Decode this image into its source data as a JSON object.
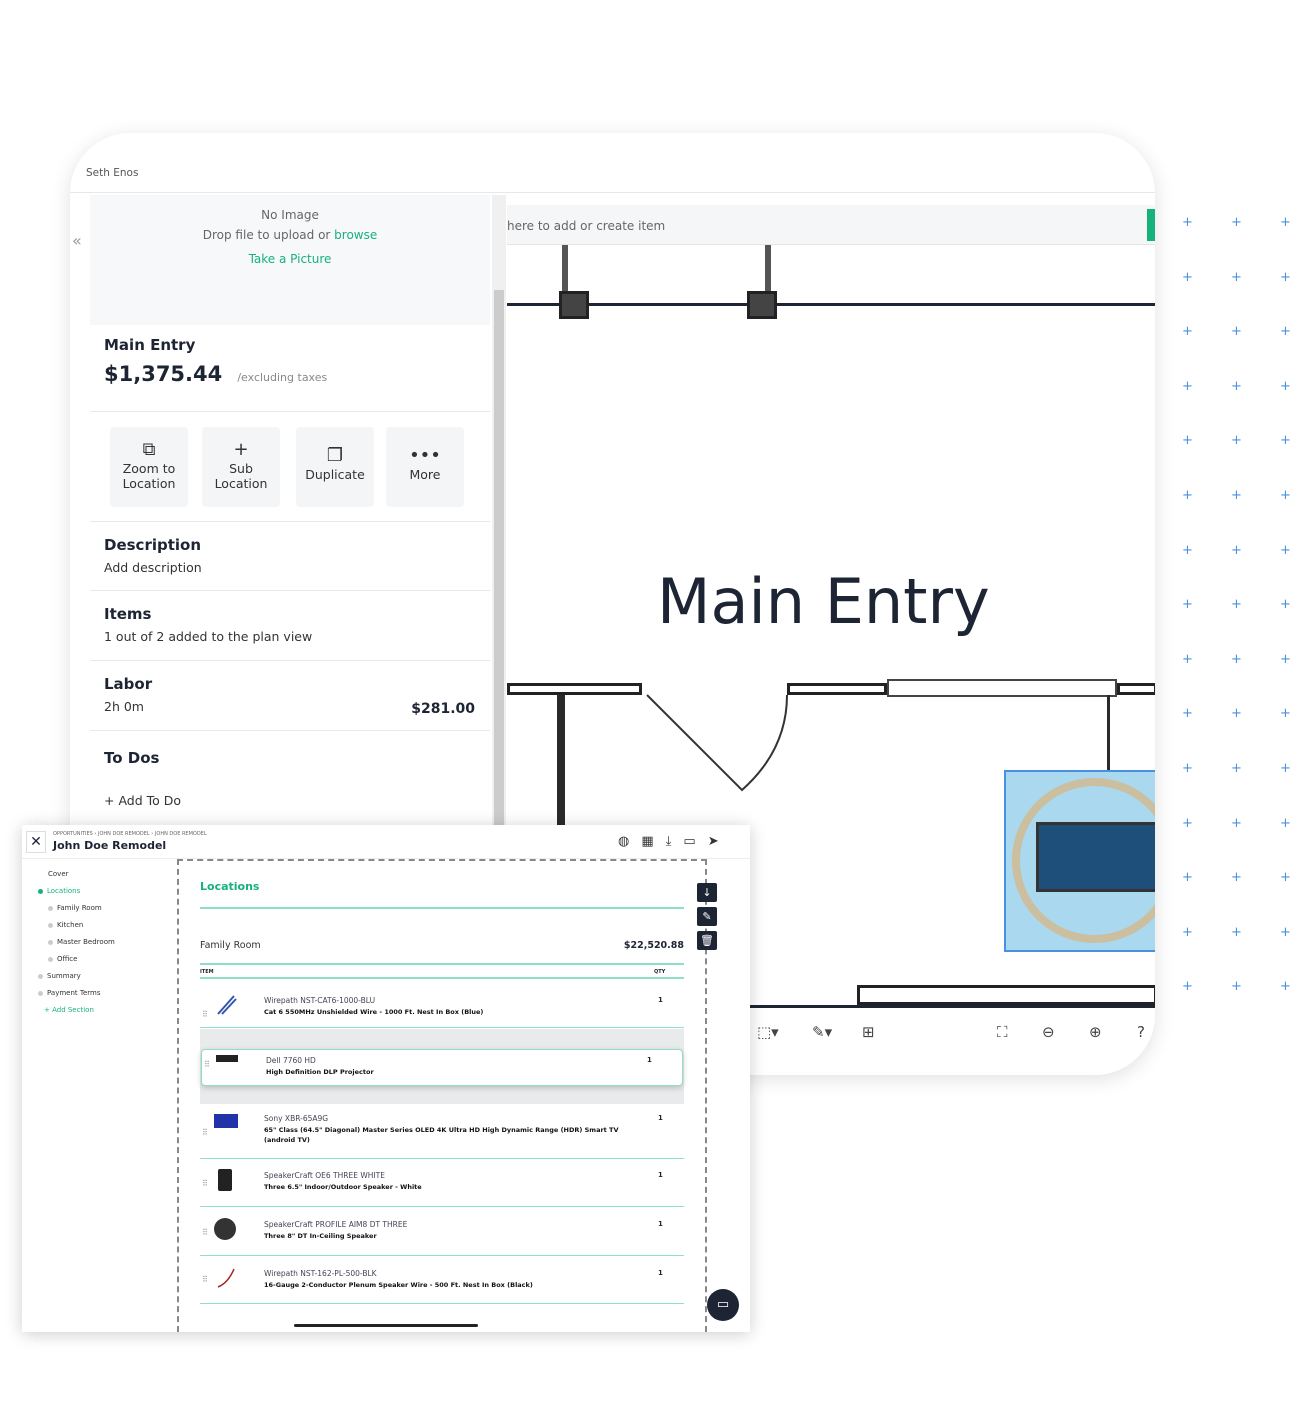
{
  "back_window": {
    "user_name": "Seth Enos",
    "image_area": {
      "no_image": "No Image",
      "drop_text": "Drop file to upload or",
      "browse": "browse",
      "take_picture": "Take a Picture"
    },
    "location": {
      "name": "Main Entry",
      "price": "$1,375.44",
      "price_note": "/excluding taxes"
    },
    "actions": [
      {
        "label": "Zoom to Location",
        "icon": "zoom-location-icon"
      },
      {
        "label": "Sub Location",
        "icon": "plus-icon"
      },
      {
        "label": "Duplicate",
        "icon": "duplicate-icon"
      },
      {
        "label": "More",
        "icon": "more-icon"
      }
    ],
    "description": {
      "title": "Description",
      "link": "Add description"
    },
    "items": {
      "title": "Items",
      "text": "1 out of 2 added to the plan view"
    },
    "labor": {
      "title": "Labor",
      "time": "2h 0m",
      "amount": "$281.00"
    },
    "todos": {
      "title": "To Dos",
      "link": "+ Add To Do"
    },
    "search_placeholder": "here to add or create item",
    "plan_label": "Main Entry"
  },
  "front_window": {
    "breadcrumb": [
      "OPPORTUNITIES",
      "JOHN DOE REMODEL",
      "JOHN DOE REMODEL"
    ],
    "title": "John Doe Remodel",
    "nav": [
      {
        "label": "Cover",
        "level": 0,
        "dot": false
      },
      {
        "label": "Locations",
        "level": 0,
        "dot": true,
        "active": true
      },
      {
        "label": "Family Room",
        "level": 1,
        "dot": true
      },
      {
        "label": "Kitchen",
        "level": 1,
        "dot": true
      },
      {
        "label": "Master Bedroom",
        "level": 1,
        "dot": true
      },
      {
        "label": "Office",
        "level": 1,
        "dot": true
      },
      {
        "label": "Summary",
        "level": 0,
        "dot": true
      },
      {
        "label": "Payment Terms",
        "level": 0,
        "dot": true
      }
    ],
    "add_section": "+ Add Section",
    "section_title": "Locations",
    "room": {
      "name": "Family Room",
      "total": "$22,520.88"
    },
    "columns": {
      "item": "ITEM",
      "qty": "QTY"
    },
    "items": [
      {
        "name": "Wirepath NST-CAT6-1000-BLU",
        "desc": "Cat 6 550MHz Unshielded Wire - 1000 Ft. Nest In Box (Blue)",
        "qty": "1"
      },
      {
        "name": "Dell 7760 HD",
        "desc": "High Definition DLP Projector",
        "qty": "1"
      },
      {
        "name": "Sony XBR-65A9G",
        "desc": "65\" Class (64.5\" Diagonal) Master Series OLED 4K Ultra HD High Dynamic Range (HDR) Smart TV (android TV)",
        "qty": "1"
      },
      {
        "name": "SpeakerCraft OE6 THREE WHITE",
        "desc": "Three 6.5\" Indoor/Outdoor Speaker - White",
        "qty": "1"
      },
      {
        "name": "SpeakerCraft PROFILE AIM8 DT THREE",
        "desc": "Three 8\" DT In-Ceiling Speaker",
        "qty": "1"
      },
      {
        "name": "Wirepath NST-162-PL-500-BLK",
        "desc": "16-Gauge 2-Conductor Plenum Speaker Wire - 500 Ft. Nest In Box (Black)",
        "qty": "1"
      }
    ]
  },
  "colors": {
    "accent": "#16b27c",
    "dark": "#1d2433",
    "decor": "#4a90e2"
  }
}
